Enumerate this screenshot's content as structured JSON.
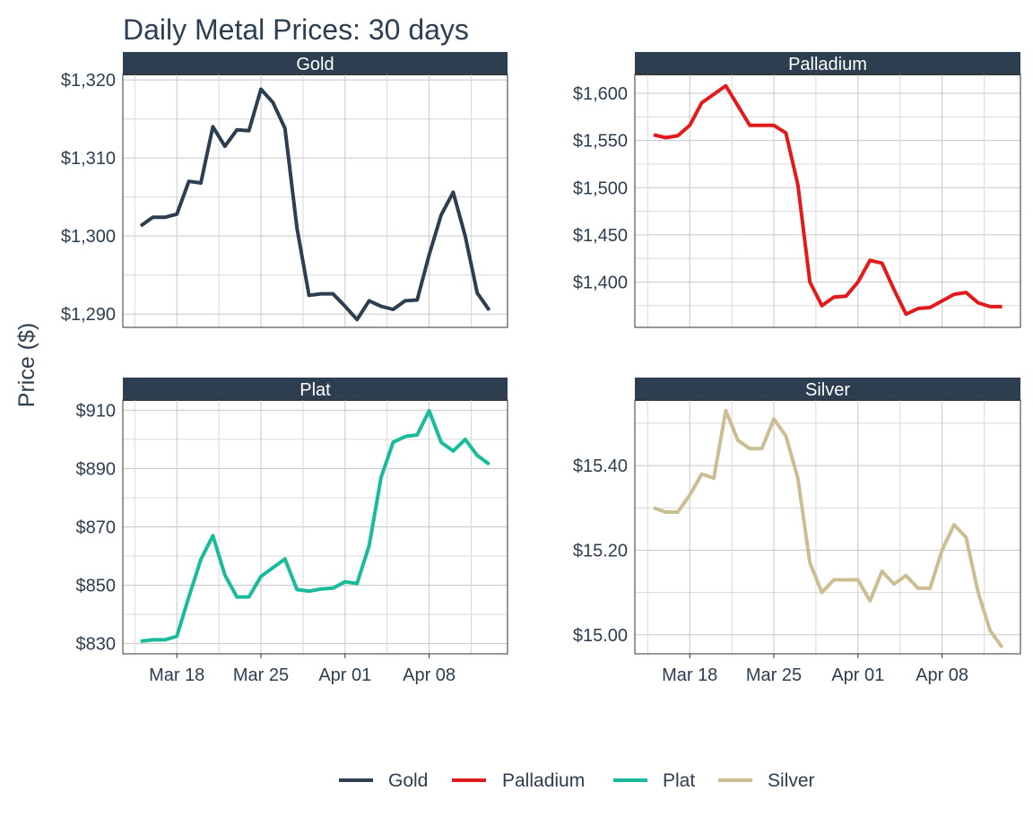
{
  "chart_data": {
    "type": "line",
    "title": "Daily Metal Prices: 30 days",
    "ylabel": "Price ($)",
    "xlabel": "",
    "grid": true,
    "legend_position": "bottom",
    "x_tick_labels": [
      "Mar 18",
      "Mar 25",
      "Apr 01",
      "Apr 08"
    ],
    "dates": [
      "Mar 15",
      "Mar 16",
      "Mar 17",
      "Mar 18",
      "Mar 19",
      "Mar 20",
      "Mar 21",
      "Mar 22",
      "Mar 23",
      "Mar 24",
      "Mar 25",
      "Mar 26",
      "Mar 27",
      "Mar 28",
      "Mar 29",
      "Mar 30",
      "Mar 31",
      "Apr 01",
      "Apr 02",
      "Apr 03",
      "Apr 04",
      "Apr 05",
      "Apr 06",
      "Apr 07",
      "Apr 08",
      "Apr 09",
      "Apr 10",
      "Apr 11",
      "Apr 12",
      "Apr 13"
    ],
    "panels": [
      {
        "name": "Gold",
        "color": "#2c3e50",
        "y_tick_labels": [
          "$1,290",
          "$1,300",
          "$1,310",
          "$1,320"
        ],
        "y_ticks": [
          1290,
          1300,
          1310,
          1320
        ],
        "ylim": [
          1288.3,
          1320.7
        ],
        "values": [
          1301.3,
          1302.4,
          1302.4,
          1302.8,
          1307.0,
          1306.8,
          1314.0,
          1311.5,
          1313.6,
          1313.5,
          1318.8,
          1317.1,
          1313.8,
          1301.0,
          1292.4,
          1292.6,
          1292.6,
          1291.0,
          1289.3,
          1291.7,
          1291.0,
          1290.6,
          1291.7,
          1291.8,
          1297.6,
          1302.7,
          1305.6,
          1300.0,
          1292.7,
          1290.5
        ]
      },
      {
        "name": "Palladium",
        "color": "#e31a1c",
        "y_tick_labels": [
          "$1,400",
          "$1,450",
          "$1,500",
          "$1,550",
          "$1,600"
        ],
        "y_ticks": [
          1400,
          1450,
          1500,
          1550,
          1600
        ],
        "ylim": [
          1352,
          1620
        ],
        "values": [
          1556,
          1553,
          1555,
          1566,
          1590,
          1599,
          1608,
          1587,
          1566,
          1566,
          1566,
          1558,
          1503,
          1400,
          1375,
          1384,
          1385,
          1400,
          1423,
          1420,
          1392,
          1366,
          1372,
          1373,
          1380,
          1387,
          1389,
          1378,
          1374,
          1374
        ]
      },
      {
        "name": "Plat",
        "color": "#18bc9c",
        "y_tick_labels": [
          "$830",
          "$850",
          "$870",
          "$890",
          "$910"
        ],
        "y_ticks": [
          830,
          850,
          870,
          890,
          910
        ],
        "ylim": [
          826.5,
          913.5
        ],
        "values": [
          830.8,
          831.3,
          831.3,
          832.5,
          846.0,
          858.8,
          867.0,
          853.5,
          846.0,
          846.0,
          853.0,
          856.0,
          859.0,
          848.5,
          848.0,
          848.7,
          849.0,
          851.2,
          850.6,
          863.5,
          887.0,
          899.0,
          901.0,
          901.5,
          909.8,
          899.0,
          896.0,
          900.0,
          894.5,
          891.5
        ]
      },
      {
        "name": "Silver",
        "color": "#ccbe93",
        "y_tick_labels": [
          "$15.00",
          "$15.20",
          "$15.40"
        ],
        "y_ticks": [
          15.0,
          15.2,
          15.4
        ],
        "ylim": [
          14.955,
          15.555
        ],
        "values": [
          15.3,
          15.29,
          15.29,
          15.33,
          15.38,
          15.37,
          15.53,
          15.46,
          15.44,
          15.44,
          15.51,
          15.47,
          15.37,
          15.17,
          15.1,
          15.13,
          15.13,
          15.13,
          15.08,
          15.15,
          15.12,
          15.14,
          15.11,
          15.11,
          15.2,
          15.26,
          15.23,
          15.1,
          15.01,
          14.97
        ]
      }
    ]
  }
}
